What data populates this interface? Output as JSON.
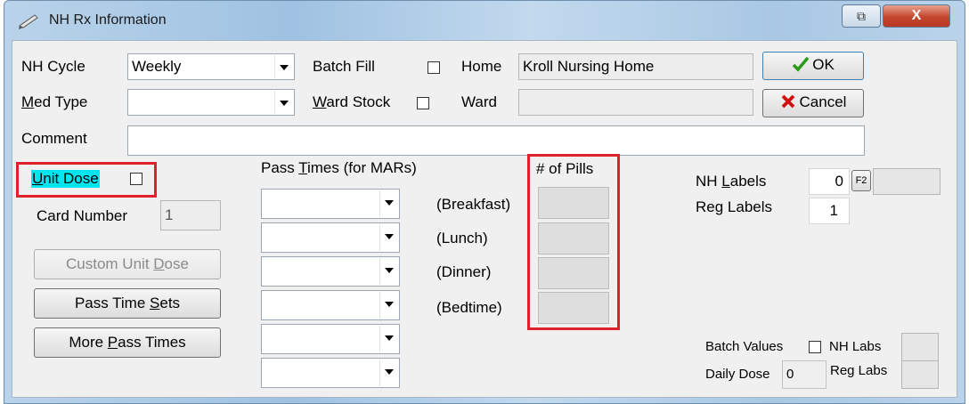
{
  "window": {
    "title": "NH Rx Information",
    "restore_glyph": "⧉",
    "close_glyph": "X"
  },
  "row1": {
    "nh_cycle_label": "NH Cycle",
    "nh_cycle_value": "Weekly",
    "batch_fill_label": "Batch Fill",
    "home_label": "Home",
    "home_value": "Kroll Nursing Home"
  },
  "row2": {
    "med_type_label": "Med Type",
    "med_type_value": "",
    "ward_stock_label": "Ward Stock",
    "ward_label": "Ward",
    "ward_value": ""
  },
  "comment": {
    "label": "Comment",
    "value": ""
  },
  "buttons": {
    "ok": "OK",
    "cancel": "Cancel",
    "custom_unit_dose": "Custom Unit Dose",
    "pass_time_sets": "Pass Time Sets",
    "more_pass_times": "More Pass Times"
  },
  "unit_dose": {
    "label": "Unit Dose",
    "card_number_label": "Card Number",
    "card_number_value": "1"
  },
  "pass_times": {
    "header": "Pass Times (for MARs)",
    "pills_header": "# of Pills",
    "meals": [
      "(Breakfast)",
      "(Lunch)",
      "(Dinner)",
      "(Bedtime)"
    ]
  },
  "labels": {
    "nh_labels_label": "NH Labels",
    "nh_labels_value": "0",
    "f2_label": "F2",
    "reg_labels_label": "Reg Labels",
    "reg_labels_value": "1"
  },
  "batch": {
    "batch_values_label": "Batch Values",
    "nh_labs_label": "NH Labs",
    "daily_dose_label": "Daily Dose",
    "daily_dose_value": "0",
    "reg_labs_label": "Reg Labs"
  },
  "colors": {
    "highlight_red": "#e0202a",
    "focus_cyan": "#00e5f0",
    "ok_check": "#2a9a1a",
    "cancel_x": "#d01010"
  }
}
